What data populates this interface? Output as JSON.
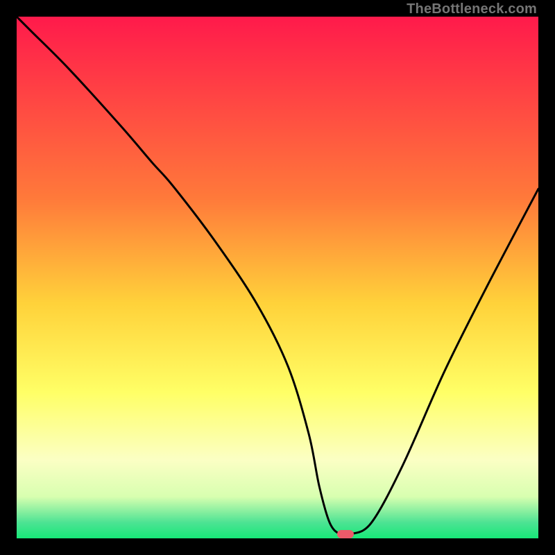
{
  "watermark": "TheBottleneck.com",
  "chart_data": {
    "type": "line",
    "title": "",
    "xlabel": "",
    "ylabel": "",
    "xlim": [
      0,
      100
    ],
    "ylim": [
      0,
      100
    ],
    "background_gradient": {
      "stops": [
        {
          "offset": 0,
          "color": "#ff1a4b"
        },
        {
          "offset": 35,
          "color": "#ff7a3a"
        },
        {
          "offset": 55,
          "color": "#ffd23a"
        },
        {
          "offset": 72,
          "color": "#ffff66"
        },
        {
          "offset": 85,
          "color": "#fbffc4"
        },
        {
          "offset": 92,
          "color": "#d8ffb0"
        },
        {
          "offset": 97,
          "color": "#4ce393"
        },
        {
          "offset": 100,
          "color": "#17e878"
        }
      ]
    },
    "series": [
      {
        "name": "bottleneck-curve",
        "color": "#000000",
        "x": [
          0,
          3,
          10,
          20,
          26,
          30,
          38,
          46,
          52,
          56,
          58,
          60,
          62,
          64,
          68,
          74,
          82,
          90,
          100
        ],
        "values": [
          100,
          97,
          90,
          79,
          72,
          67.5,
          57,
          45,
          33,
          20,
          10,
          3,
          0.8,
          0.8,
          3,
          14,
          32,
          48,
          67
        ]
      }
    ],
    "marker": {
      "x": 63,
      "y": 0.8,
      "color": "#ed5a6a",
      "width_pct": 3.2,
      "height_pct": 1.6
    }
  }
}
